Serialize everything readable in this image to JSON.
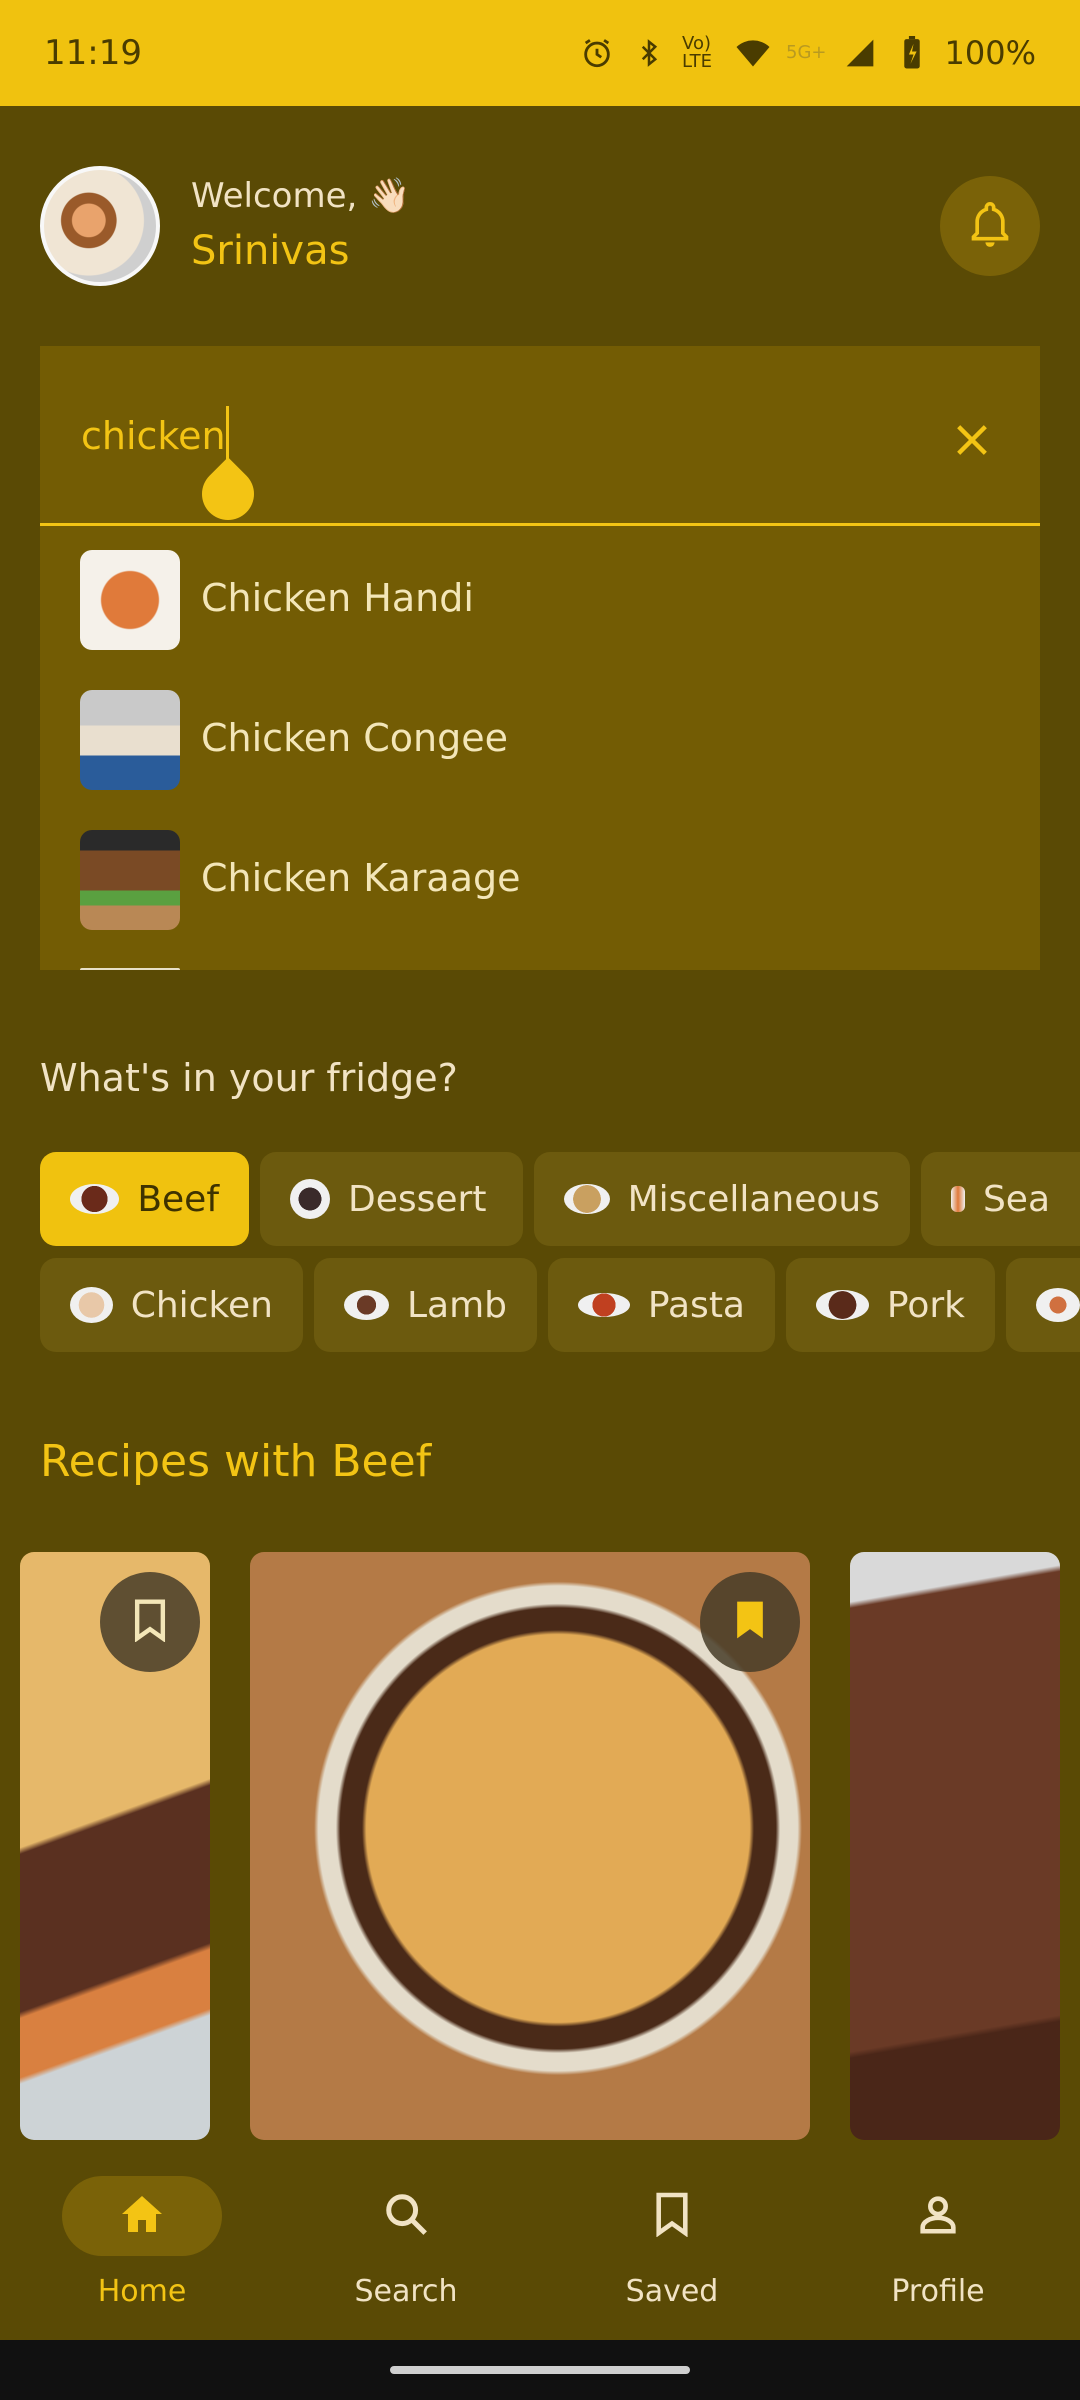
{
  "status_bar": {
    "time": "11:19",
    "volte": "Vo) LTE",
    "network": "5G+",
    "battery": "100%",
    "icons": [
      "alarm-icon",
      "bluetooth-icon",
      "volte-icon",
      "wifi-icon",
      "signal-icon",
      "battery-icon"
    ]
  },
  "header": {
    "welcome": "Welcome, 👋🏻",
    "name": "Srinivas",
    "bell_icon": "bell-icon"
  },
  "search": {
    "value": "chicken",
    "clear_icon": "close-icon",
    "suggestions": [
      {
        "label": "Chicken Handi"
      },
      {
        "label": "Chicken Congee"
      },
      {
        "label": "Chicken Karaage"
      }
    ]
  },
  "fridge": {
    "title": "What's in your fridge?",
    "chips_row1": [
      "Beef",
      "Dessert",
      "Miscellaneous",
      "Sea"
    ],
    "chips_row2": [
      "Chicken",
      "Lamb",
      "Pasta",
      "Pork"
    ],
    "selected": "Beef"
  },
  "recipes": {
    "title": "Recipes with Beef"
  },
  "nav": {
    "items": [
      {
        "label": "Home",
        "icon": "home-icon"
      },
      {
        "label": "Search",
        "icon": "search-icon"
      },
      {
        "label": "Saved",
        "icon": "bookmark-icon"
      },
      {
        "label": "Profile",
        "icon": "profile-icon"
      }
    ],
    "active": "Home"
  },
  "colors": {
    "accent": "#f3c414",
    "background": "#5a4a05",
    "status_bar": "#f0c20f"
  }
}
